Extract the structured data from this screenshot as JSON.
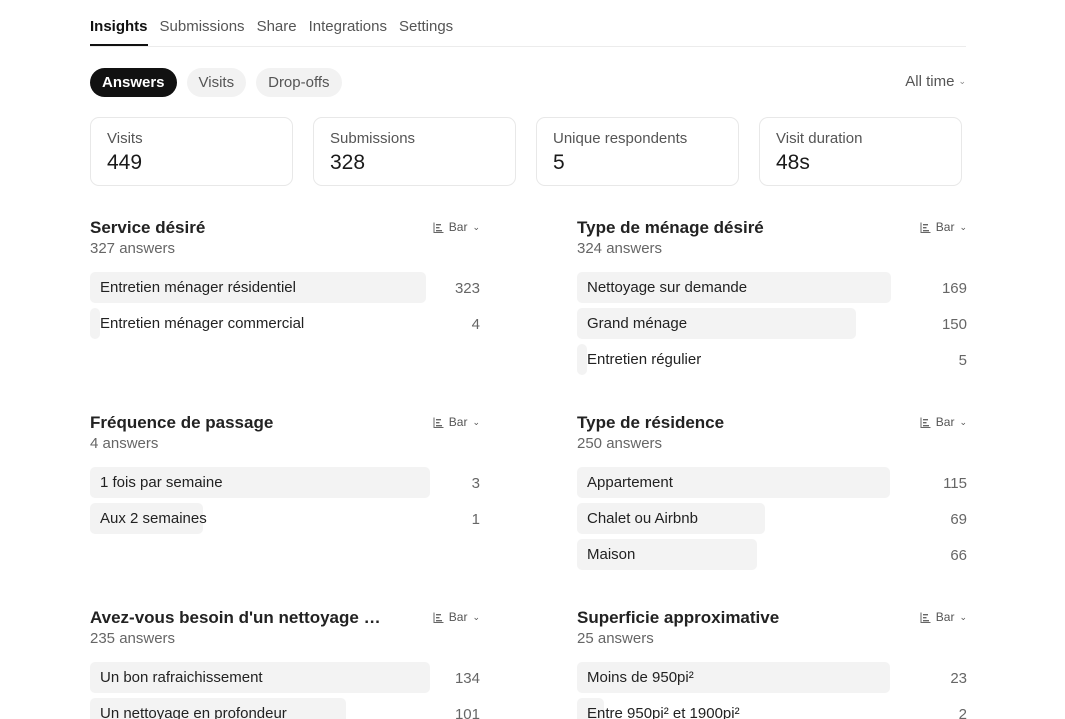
{
  "tabs": [
    {
      "label": "Insights",
      "active": true
    },
    {
      "label": "Submissions",
      "active": false
    },
    {
      "label": "Share",
      "active": false
    },
    {
      "label": "Integrations",
      "active": false
    },
    {
      "label": "Settings",
      "active": false
    }
  ],
  "filters": [
    {
      "label": "Answers",
      "active": true
    },
    {
      "label": "Visits",
      "active": false
    },
    {
      "label": "Drop-offs",
      "active": false
    }
  ],
  "time_filter": "All time",
  "stats": [
    {
      "label": "Visits",
      "value": "449"
    },
    {
      "label": "Submissions",
      "value": "328"
    },
    {
      "label": "Unique respondents",
      "value": "5"
    },
    {
      "label": "Visit duration",
      "value": "48s"
    }
  ],
  "bar_label": "Bar",
  "sections": [
    {
      "title": "Service désiré",
      "count": "327 answers",
      "max": 327,
      "rows": [
        {
          "label": "Entretien ménager résidentiel",
          "value": 323
        },
        {
          "label": "Entretien ménager commercial",
          "value": 4
        }
      ]
    },
    {
      "title": "Type de ménage désiré",
      "count": "324 answers",
      "max": 183,
      "rows": [
        {
          "label": "Nettoyage sur demande",
          "value": 169
        },
        {
          "label": "Grand ménage",
          "value": 150
        },
        {
          "label": "Entretien régulier",
          "value": 5
        }
      ]
    },
    {
      "title": "Fréquence de passage",
      "count": "4 answers",
      "max": 3,
      "rows": [
        {
          "label": "1 fois par semaine",
          "value": 3
        },
        {
          "label": "Aux 2 semaines",
          "value": 1
        }
      ]
    },
    {
      "title": "Type de résidence",
      "count": "250 answers",
      "max": 125,
      "rows": [
        {
          "label": "Appartement",
          "value": 115
        },
        {
          "label": "Chalet ou Airbnb",
          "value": 69
        },
        {
          "label": "Maison",
          "value": 66
        }
      ]
    },
    {
      "title": "Avez-vous besoin d'un nettoyage plus en profondeur",
      "count": "235 answers",
      "max": 134,
      "rows": [
        {
          "label": "Un bon rafraichissement",
          "value": 134
        },
        {
          "label": "Un nettoyage en profondeur",
          "value": 101
        }
      ]
    },
    {
      "title": "Superficie approximative",
      "count": "25 answers",
      "max": 25,
      "rows": [
        {
          "label": "Moins de 950pi²",
          "value": 23
        },
        {
          "label": "Entre 950pi² et 1900pi²",
          "value": 2
        }
      ]
    }
  ]
}
